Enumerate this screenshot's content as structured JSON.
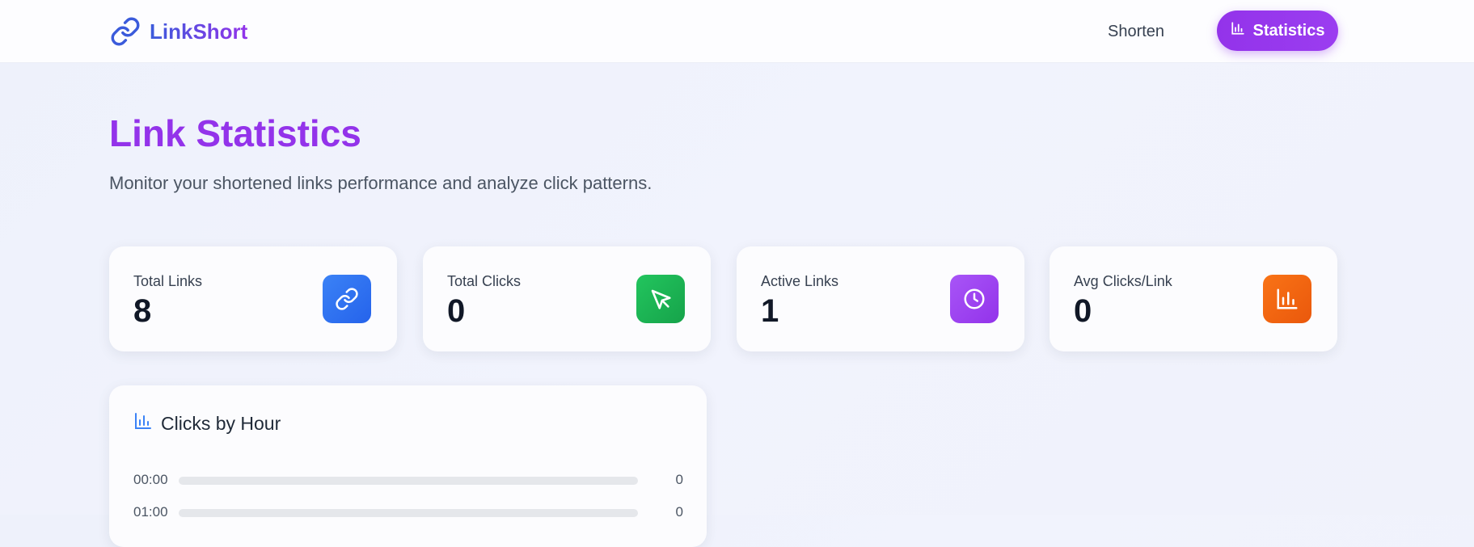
{
  "brand": {
    "name": "LinkShort",
    "icon": "link-icon",
    "gradient": [
      "#3b5bdb",
      "#9333ea"
    ]
  },
  "nav": {
    "shorten_label": "Shorten",
    "statistics_label": "Statistics",
    "statistics_icon": "bar-chart-icon",
    "accent": "#9333ea"
  },
  "page": {
    "title": "Link Statistics",
    "subtitle": "Monitor your shortened links performance and analyze click patterns."
  },
  "stats": [
    {
      "label": "Total Links",
      "value": "8",
      "icon": "link-icon",
      "color": "#3b82f6"
    },
    {
      "label": "Total Clicks",
      "value": "0",
      "icon": "cursor-icon",
      "color": "#22c55e"
    },
    {
      "label": "Active Links",
      "value": "1",
      "icon": "clock-icon",
      "color": "#a855f7"
    },
    {
      "label": "Avg Clicks/Link",
      "value": "0",
      "icon": "bar-chart-icon",
      "color": "#f97316"
    }
  ],
  "clicks_by_hour": {
    "title": "Clicks by Hour",
    "icon": "bar-chart-icon",
    "rows": [
      {
        "hour": "00:00",
        "count": "0",
        "fill": 0
      },
      {
        "hour": "01:00",
        "count": "0",
        "fill": 0
      }
    ]
  }
}
